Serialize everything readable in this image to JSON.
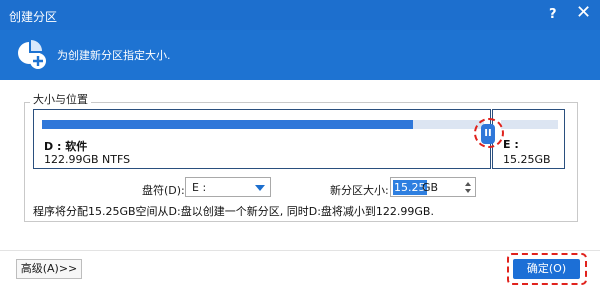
{
  "window": {
    "title": "创建分区",
    "help": "?",
    "close": "✕"
  },
  "banner": {
    "text": "为创建新分区指定大小."
  },
  "group": {
    "title": "大小与位置"
  },
  "partitions": {
    "existing": {
      "name": "D : 软件",
      "size": "122.99GB NTFS",
      "fill_fraction": 0.84
    },
    "new": {
      "name": "E :",
      "size": "15.25GB"
    },
    "handle_glyph": "II"
  },
  "form": {
    "drive_label": "盘符(D):",
    "drive_value": "E :",
    "size_label": "新分区大小:",
    "size_value": "15.25",
    "size_unit": "GB"
  },
  "message": "程序将分配15.25GB空间从D:盘以创建一个新分区, 同时D:盘将减小到122.99GB.",
  "footer": {
    "advanced_label": "高级(A)>>",
    "ok_label": "确定(O)"
  },
  "colors": {
    "title_bar": "#1d6fce",
    "accent": "#2f77d9",
    "highlight_ring": "#e0221c"
  }
}
